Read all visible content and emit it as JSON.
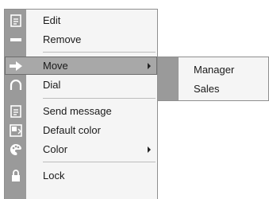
{
  "menu": {
    "items": [
      {
        "label": "Edit",
        "icon": "edit-icon"
      },
      {
        "label": "Remove",
        "icon": "remove-icon"
      },
      {
        "label": "Move",
        "icon": "move-arrow-icon",
        "has_submenu": true,
        "selected": true
      },
      {
        "label": "Dial",
        "icon": "dial-icon"
      },
      {
        "label": "Send message",
        "icon": "message-icon"
      },
      {
        "label": "Default color",
        "icon": "default-color-icon"
      },
      {
        "label": "Color",
        "icon": "palette-icon",
        "has_submenu": true
      },
      {
        "label": "Lock",
        "icon": "lock-icon"
      }
    ]
  },
  "submenu": {
    "items": [
      {
        "label": "Manager"
      },
      {
        "label": "Sales"
      }
    ]
  },
  "colors": {
    "gutter": "#9a9a9a",
    "menu_bg": "#f5f5f5",
    "selected_bg": "#a8a8a8",
    "border": "#8f8f8f"
  }
}
